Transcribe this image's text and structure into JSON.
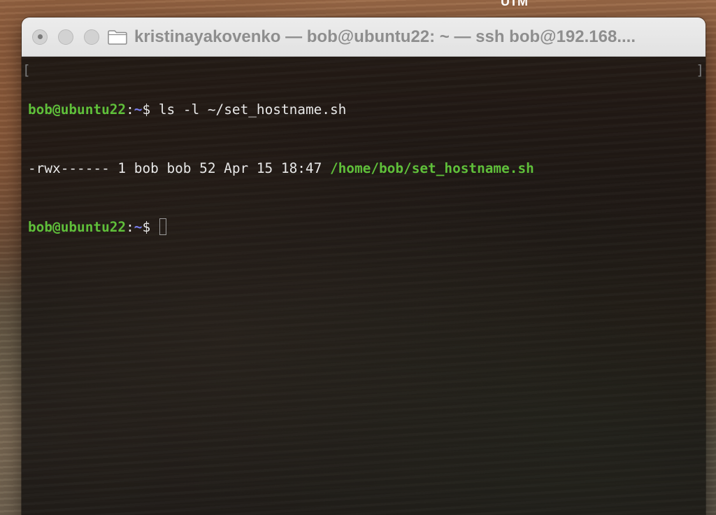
{
  "desktop": {
    "menubar_fragment": "UTM"
  },
  "window": {
    "title": "kristinayakovenko — bob@ubuntu22: ~ — ssh bob@192.168....",
    "title_icon": "folder-icon",
    "traffic_lights": [
      "close-button",
      "minimize-button",
      "zoom-button"
    ]
  },
  "terminal": {
    "colors": {
      "user": "#5fbf3a",
      "tilde": "#7a7ff0",
      "path": "#5fbf3a",
      "text": "#e8e8e8"
    },
    "line1": {
      "user_host": "bob@ubuntu22",
      "colon": ":",
      "cwd": "~",
      "prompt": "$ ",
      "command": "ls -l ~/set_hostname.sh"
    },
    "line2": {
      "listing": "-rwx------ 1 bob bob 52 Apr 15 18:47 ",
      "path": "/home/bob/set_hostname.sh"
    },
    "line3": {
      "user_host": "bob@ubuntu22",
      "colon": ":",
      "cwd": "~",
      "prompt": "$ "
    },
    "bracket_left": "[",
    "bracket_right": "]"
  }
}
